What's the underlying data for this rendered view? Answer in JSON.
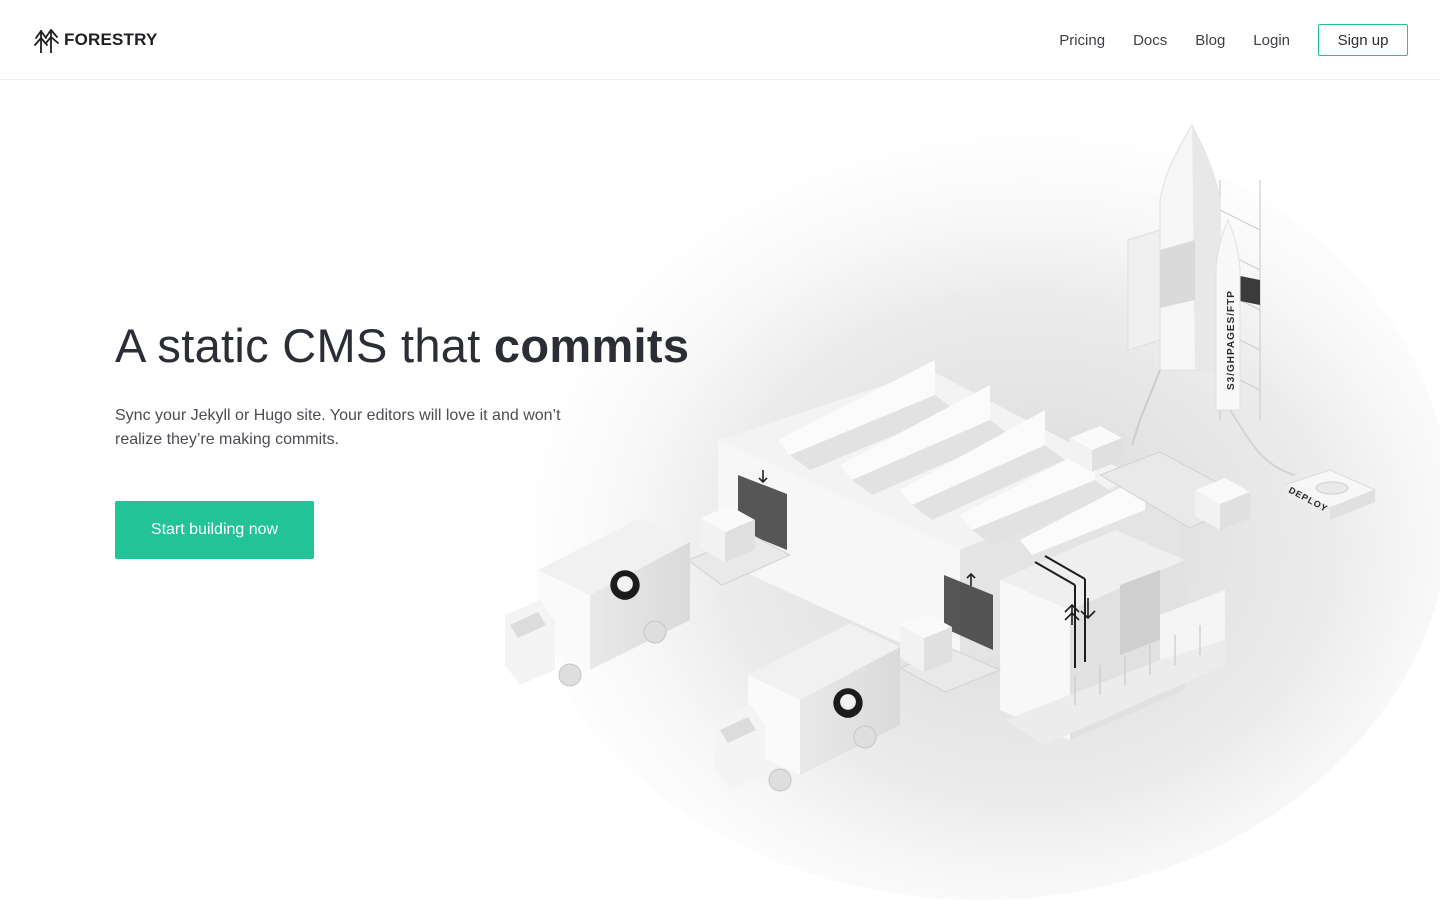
{
  "header": {
    "logo_text": "FORESTRY",
    "nav": {
      "pricing": "Pricing",
      "docs": "Docs",
      "blog": "Blog",
      "login": "Login",
      "signup": "Sign up"
    }
  },
  "hero": {
    "headline_regular": "A static CMS that ",
    "headline_bold": "commits",
    "subhead": "Sync your Jekyll or Hugo site. Your editors will love it and won’t realize they’re making commits.",
    "cta": "Start building now",
    "illustration": {
      "rocket_label": "S3/GHPAGES/FTP",
      "deploy_label": "DEPLOY"
    }
  },
  "colors": {
    "accent": "#21c397",
    "text": "#2b2e34",
    "background": "#ffffff"
  },
  "icons": [
    "forestry-tree-logo-icon",
    "github-octocat-icon"
  ]
}
